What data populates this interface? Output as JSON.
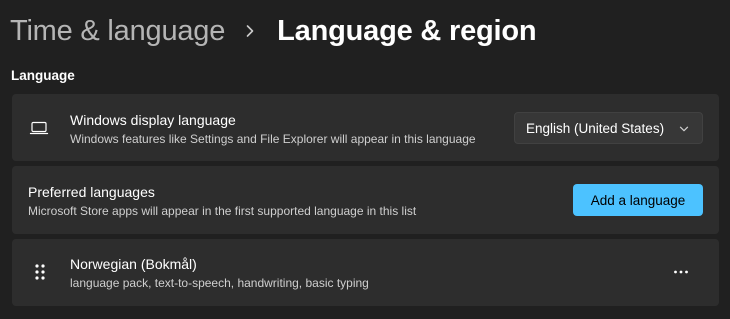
{
  "breadcrumb": {
    "parent": "Time & language",
    "current": "Language & region",
    "separator_icon": "chevron-right-icon"
  },
  "language_section": {
    "header": "Language",
    "display_language": {
      "icon": "laptop-icon",
      "title": "Windows display language",
      "description": "Windows features like Settings and File Explorer will appear in this language",
      "selected": "English (United States)",
      "dropdown_icon": "chevron-down-icon"
    },
    "preferred_languages": {
      "title": "Preferred languages",
      "description": "Microsoft Store apps will appear in the first supported language in this list",
      "add_button_label": "Add a language"
    },
    "languages": [
      {
        "drag_icon": "drag-handle-icon",
        "name": "Norwegian (Bokmål)",
        "features": "language pack, text-to-speech, handwriting, basic typing",
        "more_icon": "more-options-icon"
      }
    ]
  },
  "colors": {
    "background": "#202020",
    "card": "#2d2d2d",
    "accent": "#4cc2ff",
    "dropdown": "#373737"
  }
}
